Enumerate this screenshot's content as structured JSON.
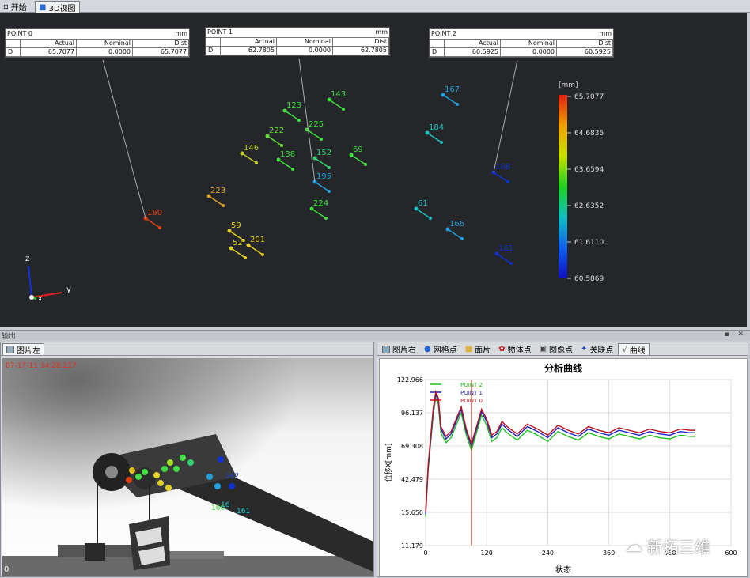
{
  "top_tabs": [
    {
      "label": "开始",
      "active": false
    },
    {
      "label": "3D视图",
      "active": true
    }
  ],
  "point_boxes": [
    {
      "title": "POINT 0",
      "unit": "mm",
      "head": [
        "",
        "Actual",
        "Nominal",
        "Dist"
      ],
      "row": [
        "D",
        "65.7077",
        "0.0000",
        "65.7077"
      ]
    },
    {
      "title": "POINT 1",
      "unit": "mm",
      "head": [
        "",
        "Actual",
        "Nominal",
        "Dist"
      ],
      "row": [
        "D",
        "62.7805",
        "0.0000",
        "62.7805"
      ]
    },
    {
      "title": "POINT 2",
      "unit": "mm",
      "head": [
        "",
        "Actual",
        "Nominal",
        "Dist"
      ],
      "row": [
        "D",
        "60.5925",
        "0.0000",
        "60.5925"
      ]
    }
  ],
  "colorbar": {
    "unit": "[mm]",
    "ticks": [
      "65.7077",
      "64.6835",
      "63.6594",
      "62.6352",
      "61.6110",
      "60.5869"
    ],
    "colors": [
      "#e02010",
      "#f0a000",
      "#c8e000",
      "#20d020",
      "#10c0c0",
      "#1060f0",
      "#1010c0"
    ]
  },
  "markers": [
    {
      "id": "143",
      "color": "#40e040"
    },
    {
      "id": "123",
      "color": "#40e040"
    },
    {
      "id": "167",
      "color": "#20a0e0"
    },
    {
      "id": "222",
      "color": "#60e030"
    },
    {
      "id": "225",
      "color": "#40e040"
    },
    {
      "id": "184",
      "color": "#20c0c0"
    },
    {
      "id": "146",
      "color": "#c0d020"
    },
    {
      "id": "138",
      "color": "#40e040"
    },
    {
      "id": "152",
      "color": "#30d070"
    },
    {
      "id": "69",
      "color": "#40e040"
    },
    {
      "id": "168",
      "color": "#1030d0"
    },
    {
      "id": "195",
      "color": "#20a0e0"
    },
    {
      "id": "223",
      "color": "#e0a020"
    },
    {
      "id": "224",
      "color": "#40e040"
    },
    {
      "id": "61",
      "color": "#20c0c0"
    },
    {
      "id": "160",
      "color": "#e04010"
    },
    {
      "id": "166",
      "color": "#20a0e0"
    },
    {
      "id": "59",
      "color": "#e0d020"
    },
    {
      "id": "201",
      "color": "#e0d020"
    },
    {
      "id": "52",
      "color": "#e0d020"
    },
    {
      "id": "161",
      "color": "#1030d0"
    }
  ],
  "axes": {
    "z": "z",
    "y": "y",
    "x": "x"
  },
  "output_label": "输出",
  "output_pins": "▪ ✕",
  "left_tabs": [
    {
      "label": "图片左",
      "active": true
    }
  ],
  "photo": {
    "timestamp": "07-17-11 14:28:217",
    "corner": "0",
    "overlay_labels": [
      "160",
      "161",
      "16",
      "167"
    ]
  },
  "right_tabs": [
    {
      "label": "图片右",
      "icon": "image-icon",
      "active": false
    },
    {
      "label": "网格点",
      "icon": "grid-point-icon",
      "active": false
    },
    {
      "label": "面片",
      "icon": "facet-icon",
      "active": false
    },
    {
      "label": "物体点",
      "icon": "object-point-icon",
      "active": false
    },
    {
      "label": "图像点",
      "icon": "image-point-icon",
      "active": false
    },
    {
      "label": "关联点",
      "icon": "link-point-icon",
      "active": false
    },
    {
      "label": "曲线",
      "icon": "curve-icon",
      "active": true
    }
  ],
  "watermark": "新拓三维",
  "chart_data": {
    "type": "line",
    "title": "分析曲线",
    "xlabel": "状态",
    "ylabel": "位移X[mm]",
    "xlim": [
      0,
      600
    ],
    "ylim": [
      -11.179,
      122.966
    ],
    "xticks": [
      "0",
      "120",
      "240",
      "360",
      "480",
      "600"
    ],
    "yticks": [
      "122.966",
      "96.137",
      "69.308",
      "42.479",
      "15.650",
      "-11.179"
    ],
    "cursor_x": 90,
    "grid": true,
    "legend_position": "top-left",
    "series": [
      {
        "name": "POINT 2",
        "color": "#20c020",
        "x": [
          0,
          5,
          10,
          15,
          20,
          25,
          30,
          40,
          50,
          60,
          70,
          80,
          90,
          100,
          110,
          120,
          130,
          140,
          150,
          160,
          180,
          200,
          220,
          240,
          260,
          280,
          300,
          320,
          340,
          360,
          380,
          400,
          420,
          440,
          460,
          480,
          500,
          520,
          530
        ],
        "y": [
          12,
          50,
          72,
          95,
          108,
          103,
          80,
          72,
          76,
          86,
          96,
          78,
          66,
          80,
          94,
          86,
          73,
          76,
          84,
          80,
          74,
          82,
          78,
          73,
          81,
          77,
          74,
          80,
          77,
          75,
          79,
          77,
          75,
          78,
          76,
          75,
          78,
          77,
          77
        ]
      },
      {
        "name": "POINT 1",
        "color": "#2020c0",
        "x": [
          0,
          5,
          10,
          15,
          20,
          25,
          30,
          40,
          50,
          60,
          70,
          80,
          90,
          100,
          110,
          120,
          130,
          140,
          150,
          160,
          180,
          200,
          220,
          240,
          260,
          280,
          300,
          320,
          340,
          360,
          380,
          400,
          420,
          440,
          460,
          480,
          500,
          520,
          530
        ],
        "y": [
          14,
          52,
          75,
          98,
          111,
          106,
          83,
          75,
          79,
          89,
          99,
          81,
          69,
          83,
          97,
          89,
          76,
          79,
          87,
          83,
          77,
          85,
          81,
          76,
          84,
          80,
          77,
          83,
          80,
          78,
          82,
          80,
          78,
          81,
          79,
          78,
          81,
          80,
          80
        ]
      },
      {
        "name": "POINT 0",
        "color": "#c01020",
        "x": [
          0,
          5,
          10,
          15,
          20,
          25,
          30,
          40,
          50,
          60,
          70,
          80,
          90,
          100,
          110,
          120,
          130,
          140,
          150,
          160,
          180,
          200,
          220,
          240,
          260,
          280,
          300,
          320,
          340,
          360,
          380,
          400,
          420,
          440,
          460,
          480,
          500,
          520,
          530
        ],
        "y": [
          16,
          54,
          77,
          100,
          113,
          108,
          85,
          77,
          81,
          91,
          101,
          83,
          71,
          85,
          99,
          91,
          78,
          81,
          89,
          85,
          79,
          87,
          83,
          78,
          86,
          82,
          79,
          85,
          82,
          80,
          84,
          82,
          80,
          83,
          81,
          80,
          83,
          82,
          82
        ]
      }
    ]
  }
}
